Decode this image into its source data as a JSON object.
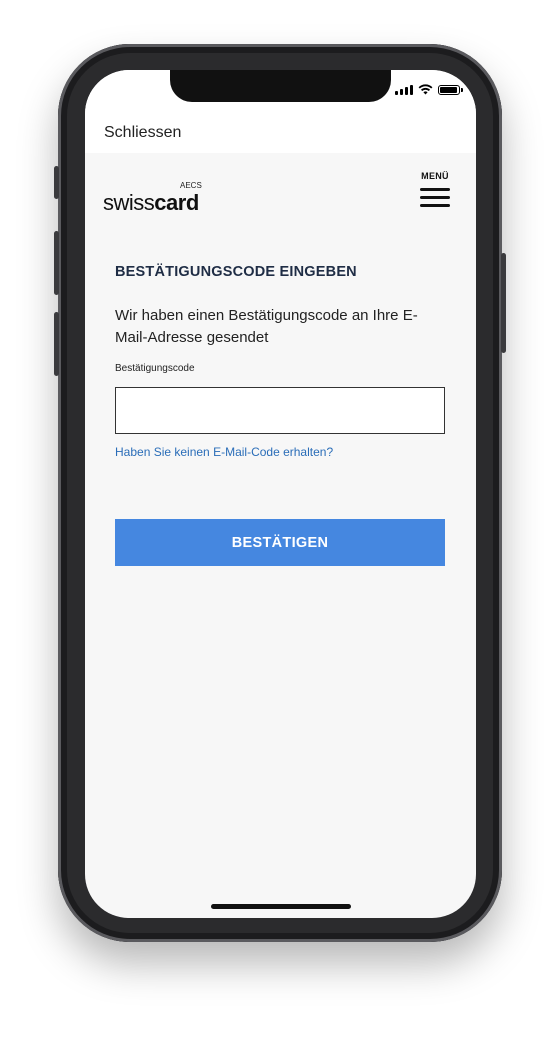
{
  "status_bar": {
    "signal_icon": "signal-icon",
    "wifi_icon": "wifi-icon",
    "battery_icon": "battery-icon"
  },
  "header": {
    "close_label": "Schliessen"
  },
  "brand": {
    "prefix": "swiss",
    "suffix": "card",
    "superscript": "AECS"
  },
  "menu": {
    "label": "MENÜ",
    "icon": "hamburger-icon"
  },
  "form": {
    "title": "BESTÄTIGUNGSCODE EINGEBEN",
    "intro": "Wir haben einen Bestätigungscode an Ihre E-Mail-Adresse gesendet",
    "field_label": "Bestätigungscode",
    "field_value": "",
    "help_link": "Haben Sie keinen E-Mail-Code erhalten?",
    "submit_label": "BESTÄTIGEN"
  },
  "colors": {
    "primary_button": "#4587e0",
    "link": "#2a6db8",
    "title": "#1f2d45"
  }
}
